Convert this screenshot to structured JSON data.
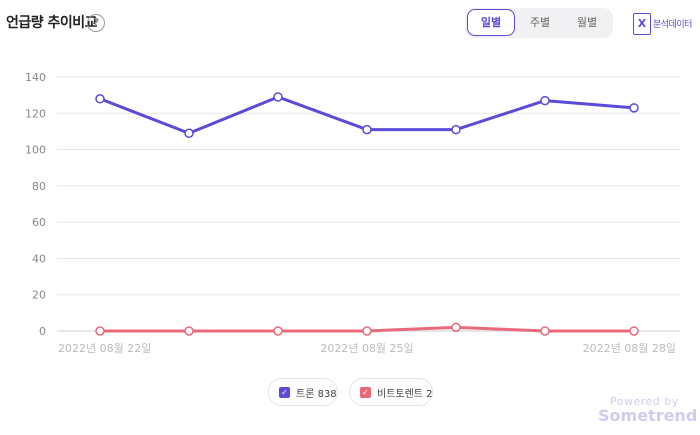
{
  "header": {
    "title": "언급량 추이비교",
    "help_symbol": "?"
  },
  "tabs": [
    {
      "label": "일별",
      "active": true
    },
    {
      "label": "주별",
      "active": false
    },
    {
      "label": "월별",
      "active": false
    }
  ],
  "export": {
    "icon_text": "X",
    "label": "분석데이터"
  },
  "colors": {
    "series1": "#5b4bd6",
    "series2": "#e8697a",
    "grid": "#e5e5e5"
  },
  "chart_data": {
    "type": "line",
    "x": [
      "2022년 08월 22일",
      "2022년 08월 23일",
      "2022년 08월 24일",
      "2022년 08월 25일",
      "2022년 08월 26일",
      "2022년 08월 27일",
      "2022년 08월 28일"
    ],
    "x_tick_labels": [
      "2022년 08월 22일",
      "2022년 08월 25일",
      "2022년 08월 28일"
    ],
    "series": [
      {
        "name": "트론",
        "values": [
          128,
          109,
          129,
          111,
          111,
          127,
          123
        ]
      },
      {
        "name": "비트토렌트",
        "values": [
          0,
          0,
          0,
          0,
          2,
          0,
          0
        ]
      }
    ],
    "ylim": [
      0,
      140
    ],
    "y_ticks": [
      0,
      20,
      40,
      60,
      80,
      100,
      120,
      140
    ],
    "grid": true,
    "legend_position": "bottom-center"
  },
  "legend": [
    {
      "label": "트론 838",
      "color": "#5b4bd6"
    },
    {
      "label": "비트토렌트 2",
      "color": "#e8697a"
    }
  ],
  "footer": {
    "powered": "Powered by",
    "brand": "Sometrend"
  }
}
